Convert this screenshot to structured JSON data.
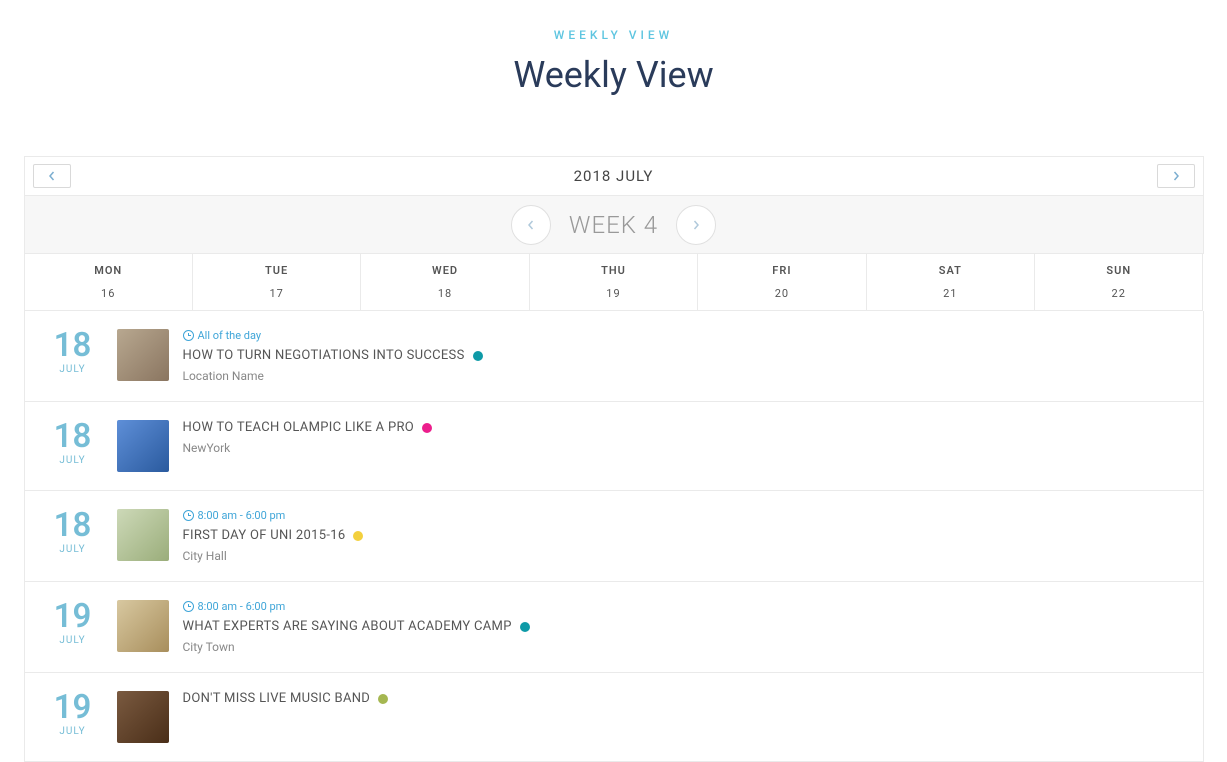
{
  "header": {
    "subtitle": "WEEKLY VIEW",
    "title": "Weekly View"
  },
  "month_nav": {
    "label": "2018 JULY"
  },
  "week_nav": {
    "label": "WEEK 4"
  },
  "days": [
    {
      "name": "MON",
      "num": "16"
    },
    {
      "name": "TUE",
      "num": "17"
    },
    {
      "name": "WED",
      "num": "18"
    },
    {
      "name": "THU",
      "num": "19"
    },
    {
      "name": "FRI",
      "num": "20"
    },
    {
      "name": "SAT",
      "num": "21"
    },
    {
      "name": "SUN",
      "num": "22"
    }
  ],
  "events": [
    {
      "day": "18",
      "month": "JULY",
      "time": "All of the day",
      "title": "HOW TO TURN NEGOTIATIONS INTO SUCCESS",
      "dot": "#0e9aa7",
      "loc": "Location Name",
      "thumb": "t1"
    },
    {
      "day": "18",
      "month": "JULY",
      "time": "",
      "title": "HOW TO TEACH OLAMPIC LIKE A PRO",
      "dot": "#ec1e8c",
      "loc": "NewYork",
      "thumb": "t2"
    },
    {
      "day": "18",
      "month": "JULY",
      "time": "8:00 am - 6:00 pm",
      "title": "FIRST DAY OF UNI 2015-16",
      "dot": "#f3d03e",
      "loc": "City Hall",
      "thumb": "t3"
    },
    {
      "day": "19",
      "month": "JULY",
      "time": "8:00 am - 6:00 pm",
      "title": "WHAT EXPERTS ARE SAYING ABOUT ACADEMY CAMP",
      "dot": "#0e9aa7",
      "loc": "City Town",
      "thumb": "t4"
    },
    {
      "day": "19",
      "month": "JULY",
      "time": "",
      "title": "DON'T MISS LIVE MUSIC BAND",
      "dot": "#a5b751",
      "loc": "",
      "thumb": "t5"
    }
  ],
  "colors": {
    "accent": "#76bdd6",
    "link": "#3fa5d8"
  }
}
